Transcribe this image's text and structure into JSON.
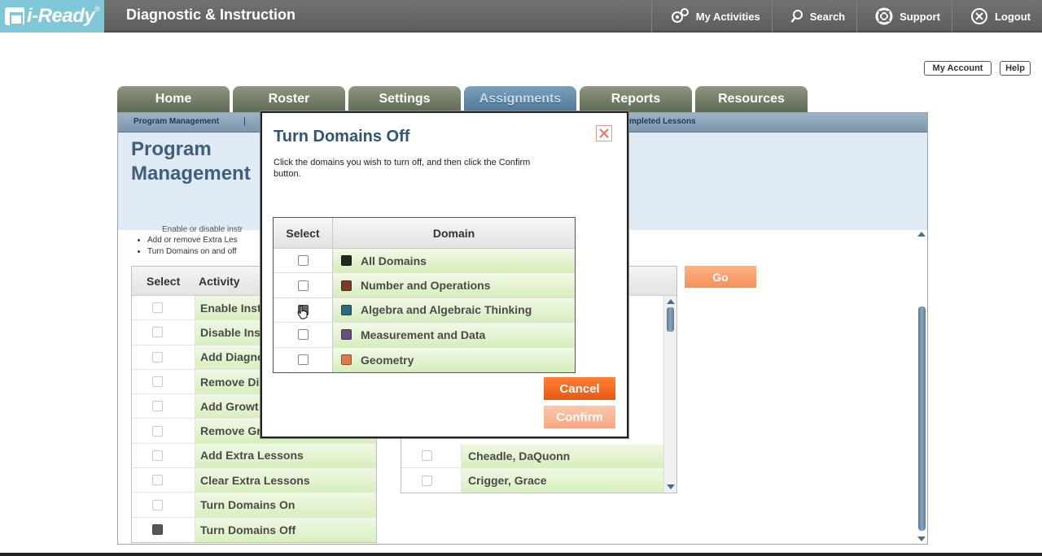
{
  "app": {
    "logo_text": "i-Ready",
    "logo_reg": "®",
    "title": "Diagnostic & Instruction"
  },
  "topnav": [
    {
      "label": "My Activities",
      "icon": "gears-icon"
    },
    {
      "label": "Search",
      "icon": "search-icon"
    },
    {
      "label": "Support",
      "icon": "lifebuoy-icon"
    },
    {
      "label": "Logout",
      "icon": "close-circle-icon"
    }
  ],
  "account": {
    "my_account": "My Account",
    "help": "Help"
  },
  "tabs": [
    {
      "label": "Home",
      "active": false
    },
    {
      "label": "Roster",
      "active": false
    },
    {
      "label": "Settings",
      "active": false
    },
    {
      "label": "Assignments",
      "active": true
    },
    {
      "label": "Reports",
      "active": false
    },
    {
      "label": "Resources",
      "active": false
    }
  ],
  "subnav": {
    "program_management": "Program Management",
    "separator": "|",
    "completed_lessons": "mpleted Lessons"
  },
  "page": {
    "title_line1": "Program",
    "title_line2": "Management"
  },
  "bullets": {
    "cut_line": "Enable or disable instr",
    "items": [
      "Add or remove Extra Les",
      "Turn Domains on and off"
    ]
  },
  "activity_table": {
    "col_select": "Select",
    "col_activity": "Activity",
    "rows": [
      {
        "label": "Enable Inst",
        "checked": false
      },
      {
        "label": "Disable Ins",
        "checked": false
      },
      {
        "label": "Add Diagno",
        "checked": false
      },
      {
        "label": "Remove Di",
        "checked": false
      },
      {
        "label": "Add Growt",
        "checked": false
      },
      {
        "label": "Remove Gr",
        "checked": false
      },
      {
        "label": "Add Extra Lessons",
        "checked": false
      },
      {
        "label": "Clear Extra Lessons",
        "checked": false
      },
      {
        "label": "Turn Domains On",
        "checked": false
      },
      {
        "label": "Turn Domains Off",
        "checked": true
      }
    ]
  },
  "go_button": "Go",
  "students": [
    {
      "label": "Cheadle, DaQuonn"
    },
    {
      "label": "Crigger, Grace"
    }
  ],
  "modal": {
    "title": "Turn Domains Off",
    "description": "Click the domains you wish to turn off, and then  click the Confirm button.",
    "col_select": "Select",
    "col_domain": "Domain",
    "domains": [
      {
        "label": "All Domains",
        "color": "#1f2a1c"
      },
      {
        "label": "Number and Operations",
        "color": "#7a3a2e"
      },
      {
        "label": "Algebra and Algebraic Thinking",
        "color": "#2c6a80"
      },
      {
        "label": "Measurement and Data",
        "color": "#6a4f7e"
      },
      {
        "label": "Geometry",
        "color": "#e07a4a"
      }
    ],
    "cancel": "Cancel",
    "confirm": "Confirm"
  },
  "colors": {
    "topbar": "#666666",
    "logo_bg": "#7fc6d9",
    "tab_active": "#5f88a8",
    "cancel": "#f26b22",
    "confirm": "#f9b596",
    "go": "#f99a66"
  }
}
